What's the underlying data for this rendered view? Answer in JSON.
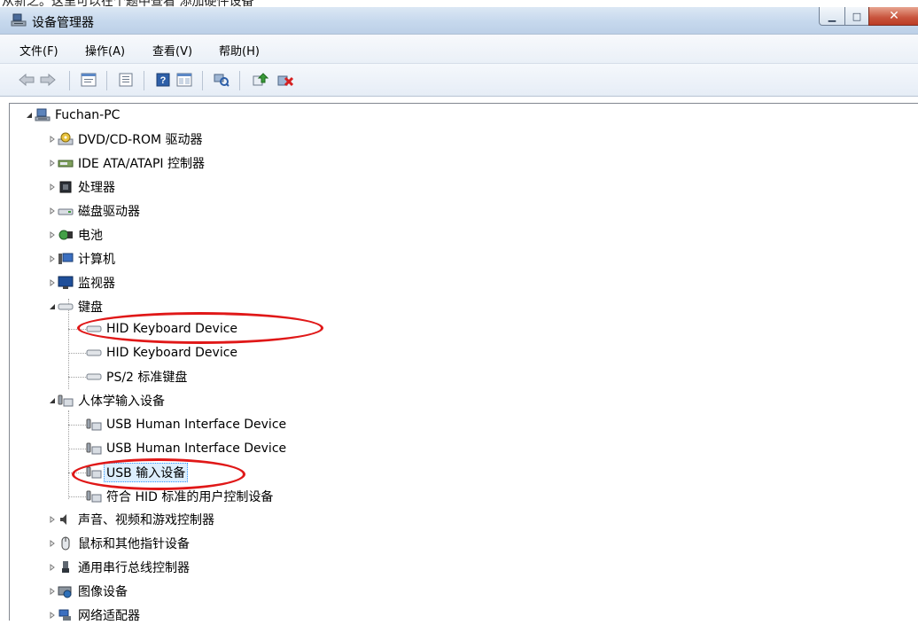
{
  "window": {
    "top_text": "从新之。这里可以在个题中查看 添加硬件设备",
    "title": "设备管理器"
  },
  "menu": [
    {
      "label": "文件(F)"
    },
    {
      "label": "操作(A)"
    },
    {
      "label": "查看(V)"
    },
    {
      "label": "帮助(H)"
    }
  ],
  "toolbar": {
    "icons": [
      "back-icon",
      "forward-icon",
      "properties-icon",
      "list-icon",
      "help-icon",
      "view-icon",
      "scan-icon",
      "update-driver-icon",
      "uninstall-icon"
    ]
  },
  "tree": {
    "root": "Fuchan-PC",
    "items": [
      {
        "label": "DVD/CD-ROM 驱动器",
        "icon": "dvd-drive-icon"
      },
      {
        "label": "IDE ATA/ATAPI 控制器",
        "icon": "ide-controller-icon"
      },
      {
        "label": "处理器",
        "icon": "processor-icon"
      },
      {
        "label": "磁盘驱动器",
        "icon": "disk-drive-icon"
      },
      {
        "label": "电池",
        "icon": "battery-icon"
      },
      {
        "label": "计算机",
        "icon": "computer-icon"
      },
      {
        "label": "监视器",
        "icon": "monitor-icon"
      },
      {
        "label": "键盘",
        "icon": "keyboard-icon",
        "children": [
          {
            "label": "HID Keyboard Device"
          },
          {
            "label": "HID Keyboard Device"
          },
          {
            "label": "PS/2 标准键盘"
          }
        ]
      },
      {
        "label": "人体学输入设备",
        "icon": "hid-icon",
        "children": [
          {
            "label": "USB Human Interface Device"
          },
          {
            "label": "USB Human Interface Device"
          },
          {
            "label": "USB 输入设备"
          },
          {
            "label": "符合 HID 标准的用户控制设备"
          }
        ]
      },
      {
        "label": "声音、视频和游戏控制器",
        "icon": "sound-icon"
      },
      {
        "label": "鼠标和其他指针设备",
        "icon": "mouse-icon"
      },
      {
        "label": "通用串行总线控制器",
        "icon": "usb-controller-icon"
      },
      {
        "label": "图像设备",
        "icon": "imaging-device-icon"
      },
      {
        "label": "网络适配器",
        "icon": "network-adapter-icon"
      }
    ]
  },
  "colors": {
    "annotation": "#e01818",
    "selection": "#3399ff"
  }
}
